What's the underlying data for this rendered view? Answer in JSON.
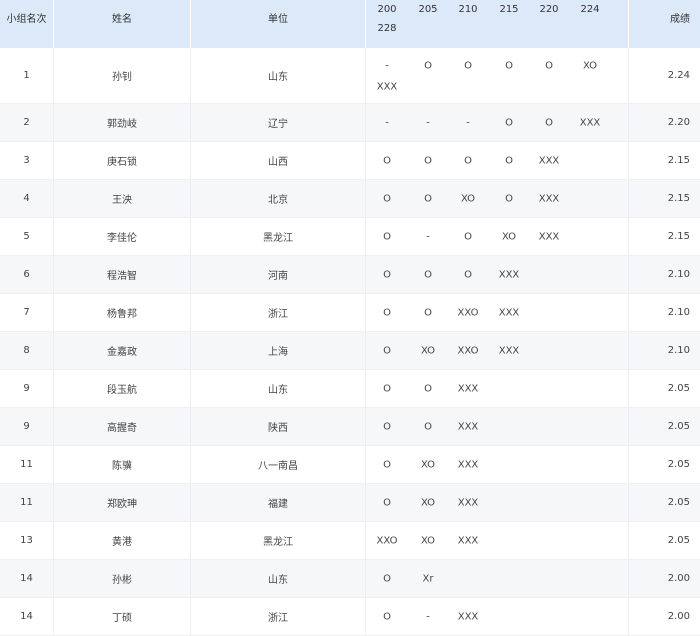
{
  "table": {
    "headers": {
      "rank": "小组名次",
      "name": "姓名",
      "unit": "单位",
      "heights": [
        "200",
        "205",
        "210",
        "215",
        "220",
        "224",
        "228"
      ],
      "result": "成绩"
    },
    "rows": [
      {
        "rank": "1",
        "name": "孙钊",
        "unit": "山东",
        "attempts": [
          "-",
          "O",
          "O",
          "O",
          "O",
          "XO",
          "XXX"
        ],
        "result": "2.24"
      },
      {
        "rank": "2",
        "name": "郭劲岐",
        "unit": "辽宁",
        "attempts": [
          "-",
          "-",
          "-",
          "O",
          "O",
          "XXX",
          ""
        ],
        "result": "2.20"
      },
      {
        "rank": "3",
        "name": "庚石锁",
        "unit": "山西",
        "attempts": [
          "O",
          "O",
          "O",
          "O",
          "XXX",
          "",
          ""
        ],
        "result": "2.15"
      },
      {
        "rank": "4",
        "name": "王泱",
        "unit": "北京",
        "attempts": [
          "O",
          "O",
          "XO",
          "O",
          "XXX",
          "",
          ""
        ],
        "result": "2.15"
      },
      {
        "rank": "5",
        "name": "李佳伦",
        "unit": "黑龙江",
        "attempts": [
          "O",
          "-",
          "O",
          "XO",
          "XXX",
          "",
          ""
        ],
        "result": "2.15"
      },
      {
        "rank": "6",
        "name": "程浩智",
        "unit": "河南",
        "attempts": [
          "O",
          "O",
          "O",
          "XXX",
          "",
          "",
          ""
        ],
        "result": "2.10"
      },
      {
        "rank": "7",
        "name": "杨鲁邦",
        "unit": "浙江",
        "attempts": [
          "O",
          "O",
          "XXO",
          "XXX",
          "",
          "",
          ""
        ],
        "result": "2.10"
      },
      {
        "rank": "8",
        "name": "金嘉政",
        "unit": "上海",
        "attempts": [
          "O",
          "XO",
          "XXO",
          "XXX",
          "",
          "",
          ""
        ],
        "result": "2.10"
      },
      {
        "rank": "9",
        "name": "段玉航",
        "unit": "山东",
        "attempts": [
          "O",
          "O",
          "XXX",
          "",
          "",
          "",
          ""
        ],
        "result": "2.05"
      },
      {
        "rank": "9",
        "name": "高握奇",
        "unit": "陕西",
        "attempts": [
          "O",
          "O",
          "XXX",
          "",
          "",
          "",
          ""
        ],
        "result": "2.05"
      },
      {
        "rank": "11",
        "name": "陈骥",
        "unit": "八一南昌",
        "attempts": [
          "O",
          "XO",
          "XXX",
          "",
          "",
          "",
          ""
        ],
        "result": "2.05"
      },
      {
        "rank": "11",
        "name": "郑欧珅",
        "unit": "福建",
        "attempts": [
          "O",
          "XO",
          "XXX",
          "",
          "",
          "",
          ""
        ],
        "result": "2.05"
      },
      {
        "rank": "13",
        "name": "黄港",
        "unit": "黑龙江",
        "attempts": [
          "XXO",
          "XO",
          "XXX",
          "",
          "",
          "",
          ""
        ],
        "result": "2.05"
      },
      {
        "rank": "14",
        "name": "孙彬",
        "unit": "山东",
        "attempts": [
          "O",
          "Xr",
          "",
          "",
          "",
          "",
          ""
        ],
        "result": "2.00"
      },
      {
        "rank": "14",
        "name": "丁硕",
        "unit": "浙江",
        "attempts": [
          "O",
          "-",
          "XXX",
          "",
          "",
          "",
          ""
        ],
        "result": "2.00"
      }
    ]
  }
}
